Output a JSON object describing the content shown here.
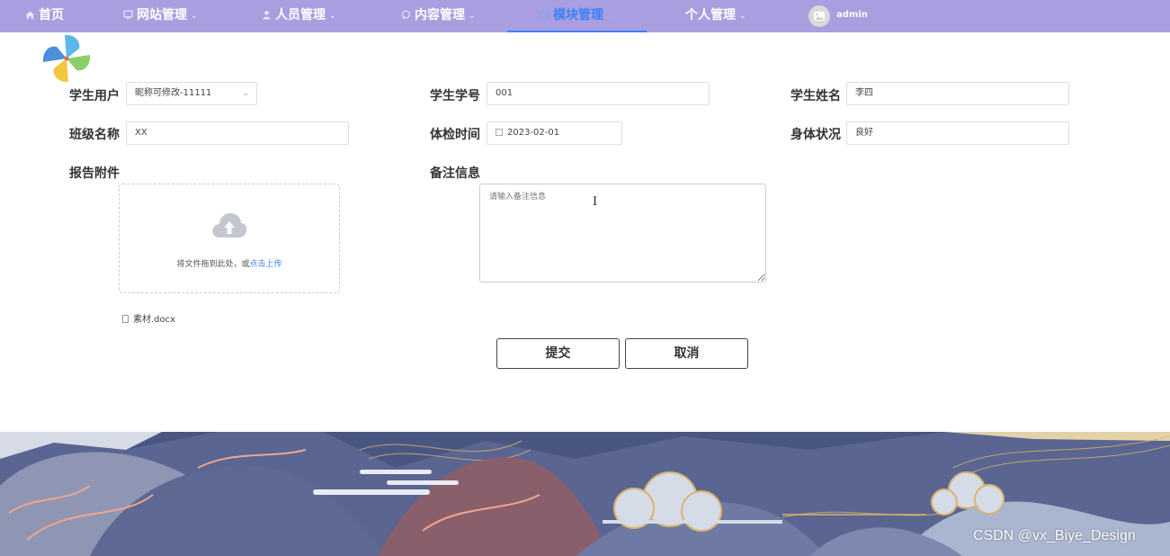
{
  "nav": {
    "items": [
      {
        "label": "首页",
        "icon": "home-icon"
      },
      {
        "label": "网站管理",
        "icon": "monitor-icon"
      },
      {
        "label": "人员管理",
        "icon": "user-icon"
      },
      {
        "label": "内容管理",
        "icon": "chat-icon"
      },
      {
        "label": "模块管理",
        "icon": "module-icon",
        "active": true
      },
      {
        "label": "个人管理",
        "icon": null
      }
    ],
    "user": {
      "name": "admin",
      "icon": "image-avatar-icon"
    },
    "colors": {
      "background": "#a99ee0",
      "active": "#3b82f6"
    }
  },
  "form": {
    "student_user": {
      "label": "学生用户",
      "value": "昵称可修改-11111"
    },
    "student_id": {
      "label": "学生学号",
      "value": "001"
    },
    "student_name": {
      "label": "学生姓名",
      "value": "李四"
    },
    "class_name": {
      "label": "班级名称",
      "value": "XX"
    },
    "exam_time": {
      "label": "体检时间",
      "value": "2023-02-01"
    },
    "health_status": {
      "label": "身体状况",
      "value": "良好"
    },
    "attachment": {
      "label": "报告附件",
      "hint": "将文件拖到此处，或",
      "link": "点击上传",
      "file_name": "素材.docx"
    },
    "remark": {
      "label": "备注信息",
      "placeholder": "请输入备注信息"
    }
  },
  "actions": {
    "submit": "提交",
    "cancel": "取消"
  },
  "watermark": "CSDN @vx_Biye_Design"
}
